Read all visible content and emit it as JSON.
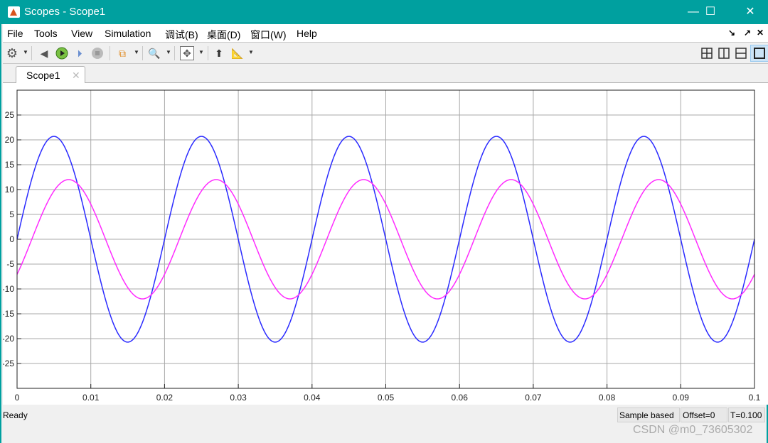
{
  "window": {
    "title": "Scopes - Scope1",
    "minimize": "—",
    "maximize": "☐",
    "close": "✕"
  },
  "menu": [
    "File",
    "Tools",
    "View",
    "Simulation",
    "调试(B)",
    "桌面(D)",
    "窗口(W)",
    "Help"
  ],
  "menu_right": {
    "undock": "↘",
    "dock": "↗",
    "close": "✕"
  },
  "toolbar": {
    "icons": [
      "settings-icon",
      "step-back-icon",
      "run-icon",
      "step-forward-icon",
      "stop-icon",
      "signal-hierarchy-icon",
      "zoom-in-icon",
      "fit-to-view-icon",
      "highlight-block-icon",
      "measurements-icon"
    ],
    "layouts": [
      "layout-2x2-icon",
      "layout-2col-icon",
      "layout-2row-icon",
      "layout-single-icon"
    ]
  },
  "tab": {
    "label": "Scope1",
    "close": "✕"
  },
  "status": {
    "left": "Ready",
    "mode": "Sample based",
    "offset": "Offset=0",
    "time": "T=0.100"
  },
  "watermark": "CSDN @m0_73605302",
  "chart_data": {
    "type": "line",
    "xlim": [
      0,
      0.1
    ],
    "ylim": [
      -30,
      30
    ],
    "grid": true,
    "xticks": [
      "0",
      "0.01",
      "0.02",
      "0.03",
      "0.04",
      "0.05",
      "0.06",
      "0.07",
      "0.08",
      "0.09",
      "0.1"
    ],
    "yticks": [
      "-25",
      "-20",
      "-15",
      "-10",
      "-5",
      "0",
      "5",
      "10",
      "15",
      "20",
      "25"
    ],
    "series": [
      {
        "color": "#2b2bff",
        "amplitude": 20.7,
        "frequency_hz": 50,
        "phase_deg": 0
      },
      {
        "color": "#ff2bff",
        "amplitude": 12,
        "frequency_hz": 50,
        "phase_deg": -36
      }
    ]
  }
}
